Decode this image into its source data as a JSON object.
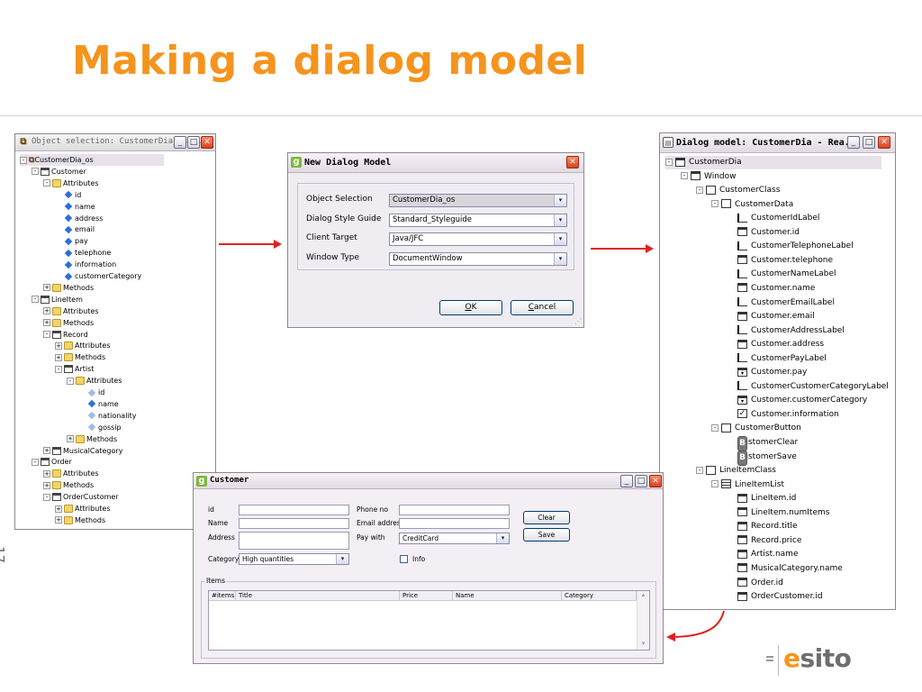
{
  "slide": {
    "title": "Making a dialog model",
    "page_number": "17",
    "logo_initial": "e",
    "logo_rest": "sito"
  },
  "object_selection": {
    "title": "Object selection: CustomerDia_os...",
    "tree": [
      {
        "label": "CustomerDia_os",
        "depth": 0,
        "icon": "root",
        "exp": "-"
      },
      {
        "label": "Customer",
        "depth": 1,
        "icon": "class",
        "exp": "-"
      },
      {
        "label": "Attributes",
        "depth": 2,
        "icon": "folder",
        "exp": "-"
      },
      {
        "label": "id",
        "depth": 3,
        "icon": "attr"
      },
      {
        "label": "name",
        "depth": 3,
        "icon": "attr"
      },
      {
        "label": "address",
        "depth": 3,
        "icon": "attr"
      },
      {
        "label": "email",
        "depth": 3,
        "icon": "attr"
      },
      {
        "label": "pay",
        "depth": 3,
        "icon": "attr"
      },
      {
        "label": "telephone",
        "depth": 3,
        "icon": "attr"
      },
      {
        "label": "information",
        "depth": 3,
        "icon": "attr"
      },
      {
        "label": "customerCategory",
        "depth": 3,
        "icon": "attr"
      },
      {
        "label": "Methods",
        "depth": 2,
        "icon": "folder",
        "exp": "+"
      },
      {
        "label": "LineItem",
        "depth": 1,
        "icon": "class",
        "exp": "-"
      },
      {
        "label": "Attributes",
        "depth": 2,
        "icon": "folder",
        "exp": "+"
      },
      {
        "label": "Methods",
        "depth": 2,
        "icon": "folder",
        "exp": "+"
      },
      {
        "label": "Record",
        "depth": 2,
        "icon": "class",
        "exp": "-"
      },
      {
        "label": "Attributes",
        "depth": 3,
        "icon": "folder",
        "exp": "+"
      },
      {
        "label": "Methods",
        "depth": 3,
        "icon": "folder",
        "exp": "+"
      },
      {
        "label": "Artist",
        "depth": 3,
        "icon": "class",
        "exp": "-"
      },
      {
        "label": "Attributes",
        "depth": 4,
        "icon": "folder",
        "exp": "-"
      },
      {
        "label": "id",
        "depth": 5,
        "icon": "attr-o"
      },
      {
        "label": "name",
        "depth": 5,
        "icon": "attr"
      },
      {
        "label": "nationality",
        "depth": 5,
        "icon": "attr-o"
      },
      {
        "label": "gossip",
        "depth": 5,
        "icon": "attr-o"
      },
      {
        "label": "Methods",
        "depth": 4,
        "icon": "folder",
        "exp": "+"
      },
      {
        "label": "MusicalCategory",
        "depth": 2,
        "icon": "class",
        "exp": "+"
      },
      {
        "label": "Order",
        "depth": 1,
        "icon": "class",
        "exp": "-"
      },
      {
        "label": "Attributes",
        "depth": 2,
        "icon": "folder",
        "exp": "+"
      },
      {
        "label": "Methods",
        "depth": 2,
        "icon": "folder",
        "exp": "+"
      },
      {
        "label": "OrderCustomer",
        "depth": 2,
        "icon": "class",
        "exp": "-"
      },
      {
        "label": "Attributes",
        "depth": 3,
        "icon": "folder",
        "exp": "+"
      },
      {
        "label": "Methods",
        "depth": 3,
        "icon": "folder",
        "exp": "+"
      }
    ]
  },
  "new_dialog": {
    "title": "New Dialog Model",
    "rows": [
      {
        "label": "Object Selection",
        "value": "CustomerDia_os"
      },
      {
        "label": "Dialog Style Guide",
        "value": "Standard_Styleguide"
      },
      {
        "label": "Client Target",
        "value": "Java/JFC"
      },
      {
        "label": "Window Type",
        "value": "DocumentWindow"
      }
    ],
    "ok_key": "O",
    "ok_rest": "K",
    "cancel_key": "C",
    "cancel_rest": "ancel"
  },
  "dialog_model": {
    "title": "Dialog model: CustomerDia - Rea...",
    "tree": [
      {
        "label": "CustomerDia",
        "depth": 0,
        "icon": "win",
        "exp": "-"
      },
      {
        "label": "Window",
        "depth": 1,
        "icon": "win",
        "exp": "-"
      },
      {
        "label": "CustomerClass",
        "depth": 2,
        "icon": "box",
        "exp": "-"
      },
      {
        "label": "CustomerData",
        "depth": 3,
        "icon": "box",
        "exp": "-"
      },
      {
        "label": "CustomerIdLabel",
        "depth": 4,
        "icon": "label"
      },
      {
        "label": "Customer.id",
        "depth": 4,
        "icon": "text"
      },
      {
        "label": "CustomerTelephoneLabel",
        "depth": 4,
        "icon": "label"
      },
      {
        "label": "Customer.telephone",
        "depth": 4,
        "icon": "text"
      },
      {
        "label": "CustomerNameLabel",
        "depth": 4,
        "icon": "label"
      },
      {
        "label": "Customer.name",
        "depth": 4,
        "icon": "text"
      },
      {
        "label": "CustomerEmailLabel",
        "depth": 4,
        "icon": "label"
      },
      {
        "label": "Customer.email",
        "depth": 4,
        "icon": "text"
      },
      {
        "label": "CustomerAddressLabel",
        "depth": 4,
        "icon": "label"
      },
      {
        "label": "Customer.address",
        "depth": 4,
        "icon": "text"
      },
      {
        "label": "CustomerPayLabel",
        "depth": 4,
        "icon": "label"
      },
      {
        "label": "Customer.pay",
        "depth": 4,
        "icon": "combo"
      },
      {
        "label": "CustomerCustomerCategoryLabel",
        "depth": 4,
        "icon": "label"
      },
      {
        "label": "Customer.customerCategory",
        "depth": 4,
        "icon": "combo"
      },
      {
        "label": "Customer.information",
        "depth": 4,
        "icon": "check"
      },
      {
        "label": "CustomerButton",
        "depth": 3,
        "icon": "box",
        "exp": "-"
      },
      {
        "label": "CustomerClear",
        "depth": 4,
        "icon": "btn"
      },
      {
        "label": "CustomerSave",
        "depth": 4,
        "icon": "btn"
      },
      {
        "label": "LineItemClass",
        "depth": 2,
        "icon": "box",
        "exp": "-"
      },
      {
        "label": "LineItemList",
        "depth": 3,
        "icon": "tbl",
        "exp": "-"
      },
      {
        "label": "LineItem.id",
        "depth": 4,
        "icon": "text"
      },
      {
        "label": "LineItem.numItems",
        "depth": 4,
        "icon": "text"
      },
      {
        "label": "Record.title",
        "depth": 4,
        "icon": "text"
      },
      {
        "label": "Record.price",
        "depth": 4,
        "icon": "text"
      },
      {
        "label": "Artist.name",
        "depth": 4,
        "icon": "text"
      },
      {
        "label": "MusicalCategory.name",
        "depth": 4,
        "icon": "text"
      },
      {
        "label": "Order.id",
        "depth": 4,
        "icon": "text"
      },
      {
        "label": "OrderCustomer.id",
        "depth": 4,
        "icon": "text"
      }
    ]
  },
  "customer": {
    "title": "Customer",
    "id_label": "id",
    "name_label": "Name",
    "address_label": "Address",
    "category_label": "Category",
    "category_value": "High quantities",
    "phone_label": "Phone no",
    "email_label": "Email address",
    "paywith_label": "Pay with",
    "paywith_value": "CreditCard",
    "info_label": "Info",
    "clear_label": "Clear",
    "save_label": "Save",
    "items_group": "Items",
    "columns": [
      "#items",
      "Title",
      "Price",
      "Name",
      "Category"
    ]
  },
  "colors": {
    "title_orange": "#f5941d",
    "arrow_red": "#e02020"
  },
  "icons": {
    "window_controls": [
      "minimize-icon",
      "maximize-icon",
      "close-icon"
    ],
    "tree_expand": "expand-toggle-icon"
  }
}
